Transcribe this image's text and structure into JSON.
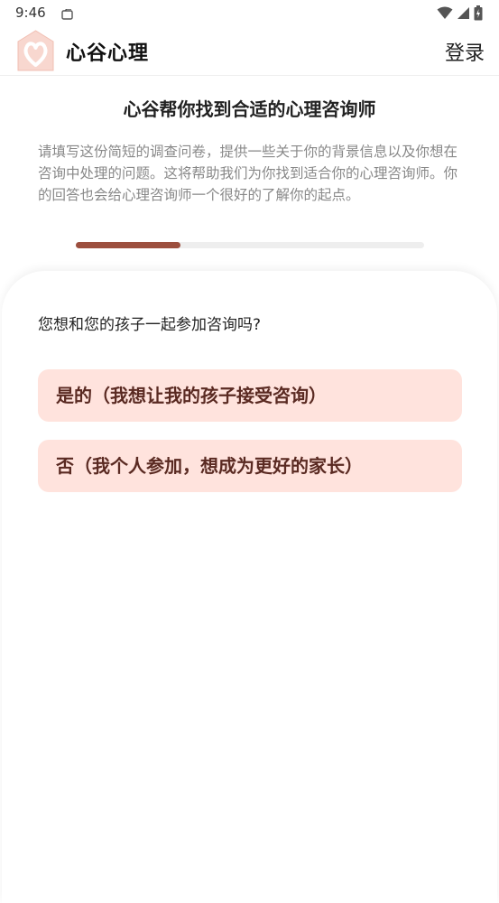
{
  "status_bar": {
    "time": "9:46"
  },
  "header": {
    "brand": "心谷心理",
    "login": "登录"
  },
  "intro": {
    "title": "心谷帮你找到合适的心理咨询师",
    "description": "请填写这份简短的调查问卷，提供一些关于你的背景信息以及你想在咨询中处理的问题。这将帮助我们为你找到适合你的心理咨询师。你的回答也会给心理咨询师一个很好的了解你的起点。",
    "progress_fraction": 0.3
  },
  "question": {
    "text": "您想和您的孩子一起参加咨询吗?",
    "options": [
      {
        "label": "是的（我想让我的孩子接受咨询）"
      },
      {
        "label": "否（我个人参加，想成为更好的家长）"
      }
    ]
  },
  "colors": {
    "accent": "#9c4f3e",
    "option_bg": "#ffe3dd",
    "logo_bg": "#f8d7cf"
  }
}
